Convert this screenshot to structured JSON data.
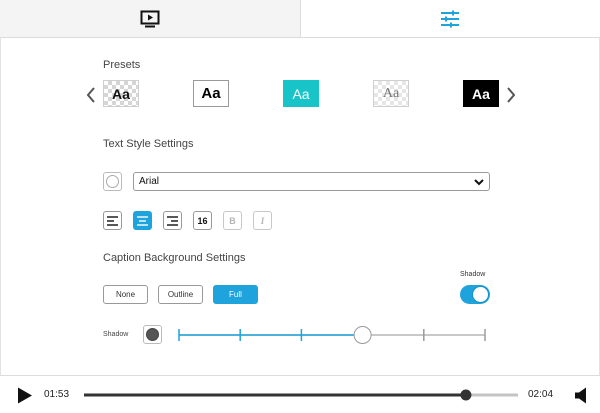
{
  "tabs": {
    "video": {
      "icon": "tv-play-icon"
    },
    "settings": {
      "icon": "sliders-icon"
    }
  },
  "presets": {
    "label": "Presets",
    "items": [
      "Aa",
      "Aa",
      "Aa",
      "Aa",
      "Aa"
    ]
  },
  "text_style": {
    "label": "Text Style Settings",
    "font": "Arial",
    "font_size": "16",
    "bold": "B",
    "italic": "I"
  },
  "caption_bg": {
    "label": "Caption Background Settings",
    "buttons": [
      "None",
      "Outline",
      "Full"
    ],
    "selected": "Full",
    "shadow_toggle_label": "Shadow",
    "shadow_on": true,
    "shadow_slider_label": "Shadow",
    "shadow_slider_value": 0.6
  },
  "player": {
    "current_time": "01:53",
    "duration": "02:04",
    "progress": 0.88
  },
  "colors": {
    "accent": "#1ea3dc",
    "preset_teal": "#19c4c9"
  }
}
